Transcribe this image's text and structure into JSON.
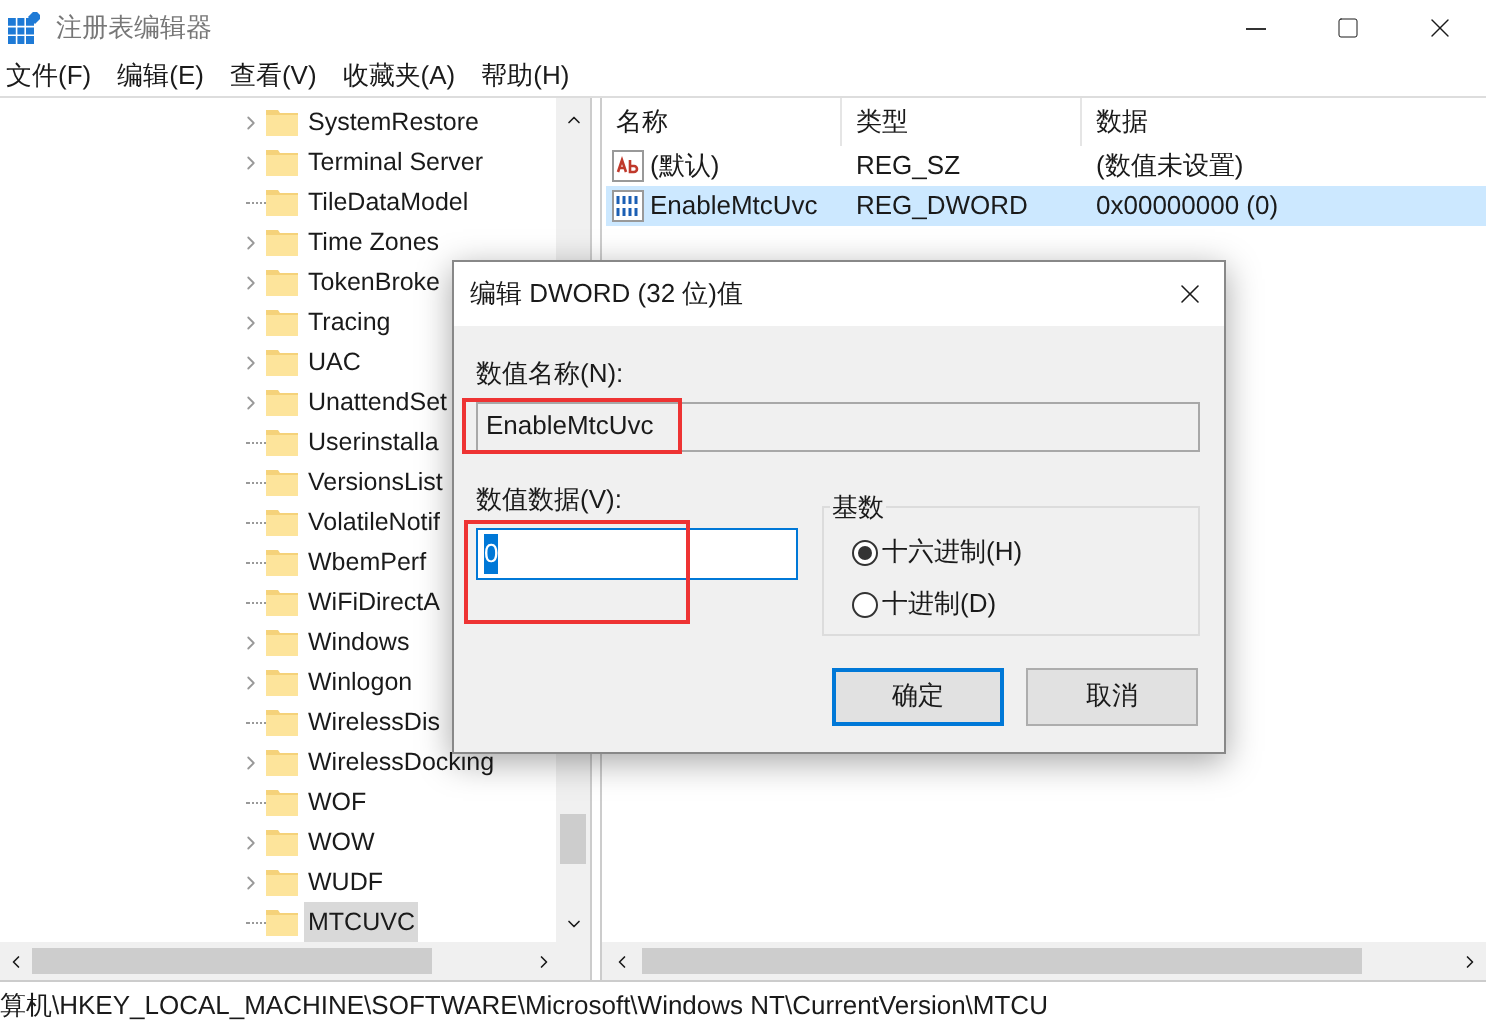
{
  "window": {
    "title": "注册表编辑器"
  },
  "menu": [
    "文件(F)",
    "编辑(E)",
    "查看(V)",
    "收藏夹(A)",
    "帮助(H)"
  ],
  "tree": {
    "items": [
      {
        "label": "SystemRestore",
        "has_children": true,
        "selected": false
      },
      {
        "label": "Terminal Server",
        "has_children": true,
        "selected": false
      },
      {
        "label": "TileDataModel",
        "has_children": false,
        "selected": false
      },
      {
        "label": "Time Zones",
        "has_children": true,
        "selected": false
      },
      {
        "label": "TokenBroke",
        "has_children": true,
        "selected": false
      },
      {
        "label": "Tracing",
        "has_children": true,
        "selected": false
      },
      {
        "label": "UAC",
        "has_children": true,
        "selected": false
      },
      {
        "label": "UnattendSet",
        "has_children": true,
        "selected": false
      },
      {
        "label": "Userinstalla",
        "has_children": false,
        "selected": false
      },
      {
        "label": "VersionsList",
        "has_children": false,
        "selected": false
      },
      {
        "label": "VolatileNotif",
        "has_children": false,
        "selected": false
      },
      {
        "label": "WbemPerf",
        "has_children": false,
        "selected": false
      },
      {
        "label": "WiFiDirectA",
        "has_children": false,
        "selected": false
      },
      {
        "label": "Windows",
        "has_children": true,
        "selected": false
      },
      {
        "label": "Winlogon",
        "has_children": true,
        "selected": false
      },
      {
        "label": "WirelessDis",
        "has_children": false,
        "selected": false
      },
      {
        "label": "WirelessDocking",
        "has_children": true,
        "selected": false
      },
      {
        "label": "WOF",
        "has_children": false,
        "selected": false
      },
      {
        "label": "WOW",
        "has_children": true,
        "selected": false
      },
      {
        "label": "WUDF",
        "has_children": true,
        "selected": false
      },
      {
        "label": "MTCUVC",
        "has_children": false,
        "selected": true
      }
    ]
  },
  "list": {
    "columns": [
      "名称",
      "类型",
      "数据"
    ],
    "rows": [
      {
        "kind": "string",
        "name": "(默认)",
        "type": "REG_SZ",
        "data": "(数值未设置)",
        "selected": false
      },
      {
        "kind": "binary",
        "name": "EnableMtcUvc",
        "type": "REG_DWORD",
        "data": "0x00000000 (0)",
        "selected": true
      }
    ]
  },
  "dialog": {
    "title": "编辑 DWORD (32 位)值",
    "name_label": "数值名称(N):",
    "name_value": "EnableMtcUvc",
    "data_label": "数值数据(V):",
    "data_value": "0",
    "base_label": "基数",
    "radios": [
      {
        "label": "十六进制(H)",
        "selected": true
      },
      {
        "label": "十进制(D)",
        "selected": false
      }
    ],
    "buttons": [
      {
        "label": "确定",
        "default": true
      },
      {
        "label": "取消",
        "default": false
      }
    ]
  },
  "status_bar": "算机\\HKEY_LOCAL_MACHINE\\SOFTWARE\\Microsoft\\Windows NT\\CurrentVersion\\MTCU"
}
